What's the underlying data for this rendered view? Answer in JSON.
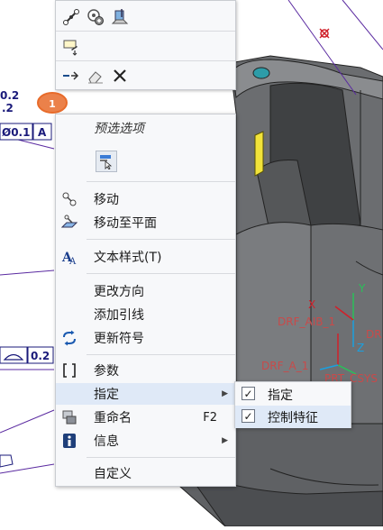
{
  "annotations": {
    "dim_a": "0.2",
    "dim_b": ".2",
    "gtol_value": "Ø0.1",
    "datum_a": "A",
    "balloon": "1",
    "flatness_value": "0.2",
    "drf_aib": "DRF_AIB_1",
    "drf_a": "DRF_A_1",
    "prt_csys": "PRT_CSYS",
    "axis_y": "Y",
    "axis_x": "X",
    "axis_z": "Z",
    "axis_dr": "DR"
  },
  "mini_toolbar": {
    "row1": [
      "chain-link-icon",
      "gear-shape-icon",
      "sketch-plane-icon"
    ],
    "row2": [
      "edit-definition-icon"
    ],
    "row3": [
      "reroute-arrow-icon",
      "eraser-icon",
      "delete-x-icon"
    ]
  },
  "context_menu": {
    "preselect_label": "预选选项",
    "items": {
      "move": {
        "label": "移动",
        "icon": "move-icon"
      },
      "move_to_plane": {
        "label": "移动至平面",
        "icon": "move-to-plane-icon"
      },
      "text_style": {
        "label": "文本样式(T)",
        "icon": "text-style-icon"
      },
      "change_direction": {
        "label": "更改方向"
      },
      "add_leader": {
        "label": "添加引线"
      },
      "update_symbol": {
        "label": "更新符号",
        "icon": "refresh-arrows-icon"
      },
      "parameters": {
        "label": "参数",
        "icon": "brackets-icon"
      },
      "assign": {
        "label": "指定",
        "icon": "",
        "has_submenu": true
      },
      "rename": {
        "label": "重命名",
        "shortcut": "F2",
        "icon": "rename-icon"
      },
      "info": {
        "label": "信息",
        "icon": "info-icon",
        "has_submenu": true
      },
      "customize": {
        "label": "自定义"
      }
    }
  },
  "submenu": {
    "items": [
      {
        "label": "指定",
        "checked": true
      },
      {
        "label": "控制特征",
        "checked": true
      }
    ]
  },
  "colors": {
    "menu_bg": "#f7f8fa",
    "highlight": "#dfe9f7",
    "model_gray": "#6b6d70",
    "balloon_orange": "#e86b2a",
    "annotation_navy": "#1a1a7a"
  }
}
